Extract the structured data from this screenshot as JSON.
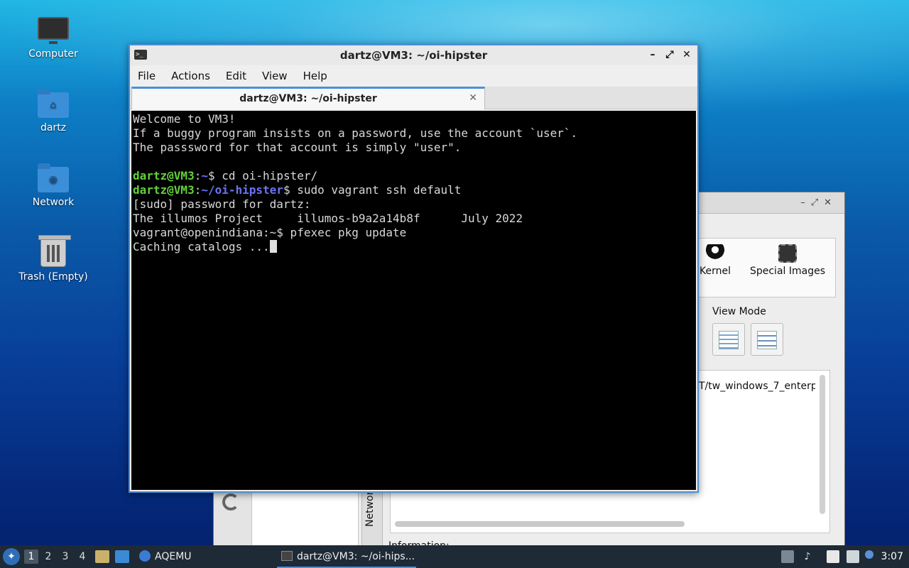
{
  "desktop": {
    "icons": [
      {
        "label": "Computer"
      },
      {
        "label": "dartz"
      },
      {
        "label": "Network"
      },
      {
        "label": "Trash (Empty)"
      }
    ]
  },
  "aqemu_window": {
    "tabs": [
      "Kernel",
      "Special Images"
    ],
    "view_mode_label": "View Mode",
    "image_path": "T/tw_windows_7_enterp",
    "network_tab": "Network",
    "info_label": "Information:"
  },
  "terminal": {
    "window_title": "dartz@VM3: ~/oi-hipster",
    "menu": [
      "File",
      "Actions",
      "Edit",
      "View",
      "Help"
    ],
    "tab_title": "dartz@VM3: ~/oi-hipster",
    "controls": {
      "minimize": "–",
      "maximize": "⤢",
      "close": "✕",
      "tab_close": "✕"
    },
    "lines": {
      "l1": "Welcome to VM3!",
      "l2": "If a buggy program insists on a password, use the account `user`.",
      "l3": "The passsword for that account is simply \"user\".",
      "l5_user": "dartz@VM3",
      "l5_colon": ":",
      "l5_path": "~",
      "l5_cmd": "$ cd oi-hipster/",
      "l6_user": "dartz@VM3",
      "l6_colon": ":",
      "l6_path": "~/oi-hipster",
      "l6_cmd": "$ sudo vagrant ssh default",
      "l7": "[sudo] password for dartz:",
      "l8": "The illumos Project     illumos-b9a2a14b8f      July 2022",
      "l9": "vagrant@openindiana:~$ pfexec pkg update",
      "l10": "Caching catalogs ..."
    }
  },
  "taskbar": {
    "workspaces": [
      "1",
      "2",
      "3",
      "4"
    ],
    "active_workspace": "1",
    "tasks": [
      {
        "label": "AQEMU"
      },
      {
        "label": "dartz@VM3: ~/oi-hips..."
      }
    ],
    "clock": "3:07"
  }
}
